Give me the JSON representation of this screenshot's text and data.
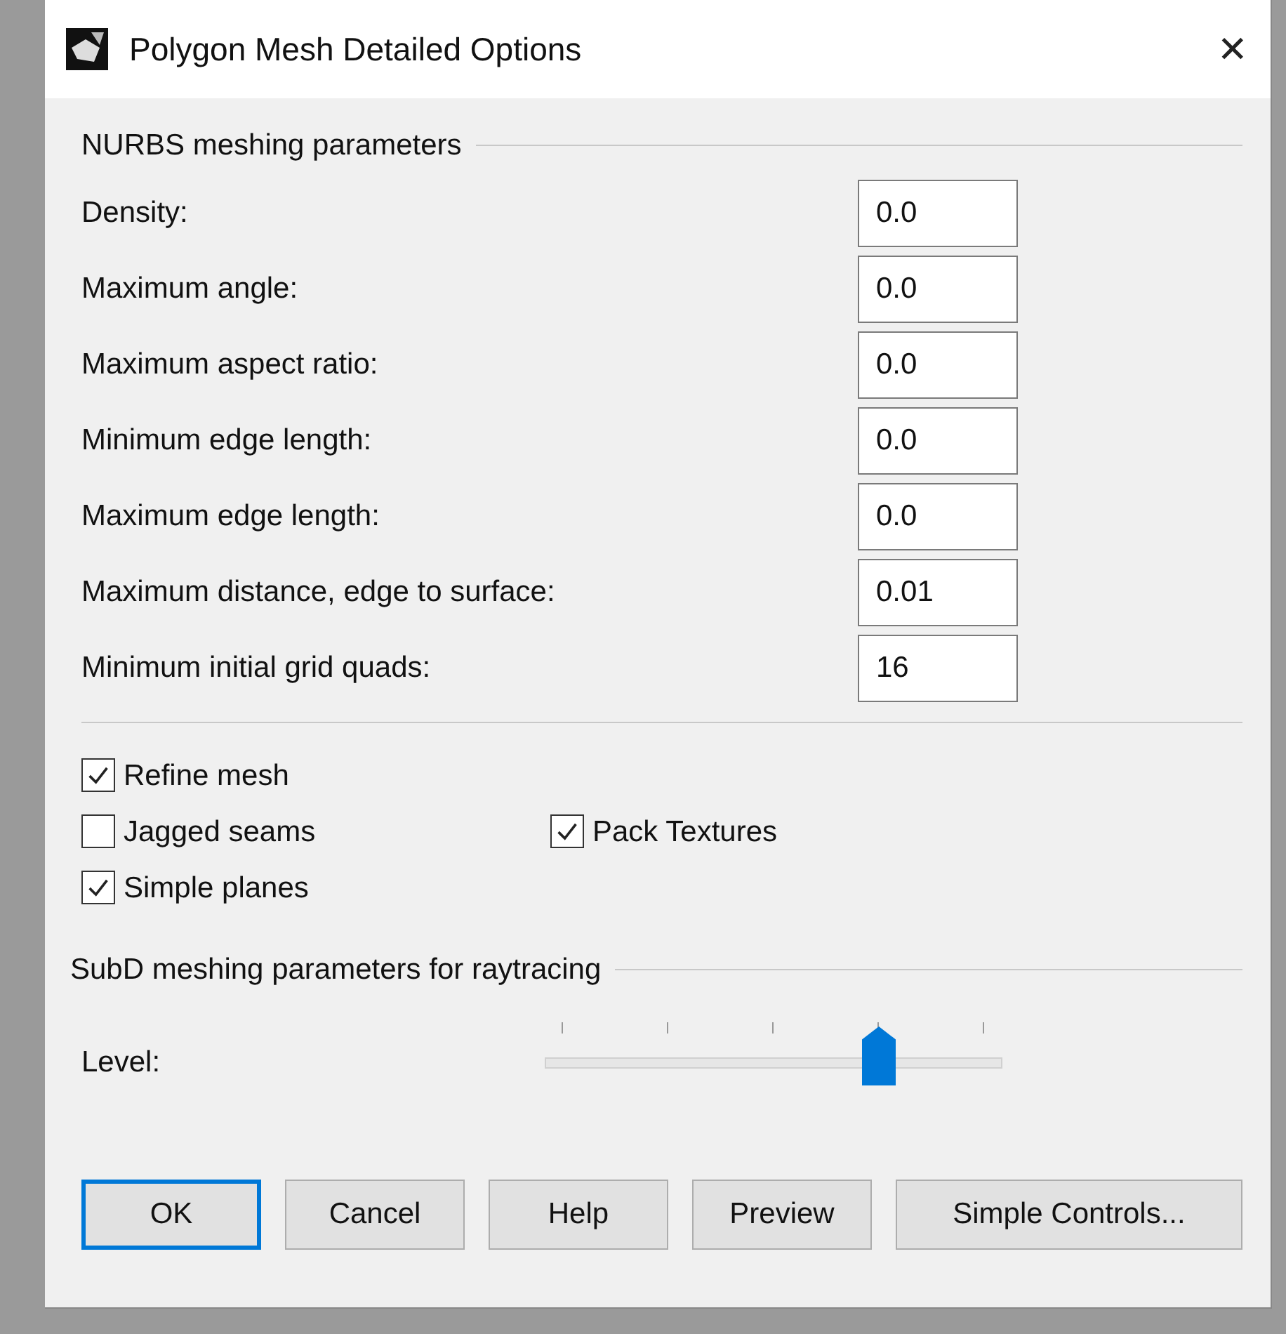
{
  "window": {
    "title": "Polygon Mesh Detailed Options",
    "close": "✕"
  },
  "nurbs": {
    "heading": "NURBS meshing parameters",
    "fields": [
      {
        "label": "Density:",
        "value": "0.0"
      },
      {
        "label": "Maximum angle:",
        "value": "0.0"
      },
      {
        "label": "Maximum aspect ratio:",
        "value": "0.0"
      },
      {
        "label": "Minimum edge length:",
        "value": "0.0"
      },
      {
        "label": "Maximum edge length:",
        "value": "0.0"
      },
      {
        "label": "Maximum distance, edge to surface:",
        "value": "0.01"
      },
      {
        "label": "Minimum initial grid quads:",
        "value": "16"
      }
    ]
  },
  "option_rows": [
    {
      "items": [
        {
          "label": "Refine mesh",
          "checked": true
        }
      ]
    },
    {
      "items": [
        {
          "label": "Jagged seams",
          "checked": false
        },
        {
          "label": "Pack Textures",
          "checked": true
        }
      ]
    },
    {
      "items": [
        {
          "label": "Simple planes",
          "checked": true
        }
      ]
    }
  ],
  "subd": {
    "heading": "SubD meshing parameters for raytracing",
    "slider": {
      "label": "Level:",
      "level": 0.75
    }
  },
  "buttons": [
    {
      "label": "OK",
      "default": true
    },
    {
      "label": "Cancel",
      "default": false
    },
    {
      "label": "Help",
      "default": false
    },
    {
      "label": "Preview",
      "default": false
    },
    {
      "label": "Simple Controls...",
      "default": false
    }
  ]
}
